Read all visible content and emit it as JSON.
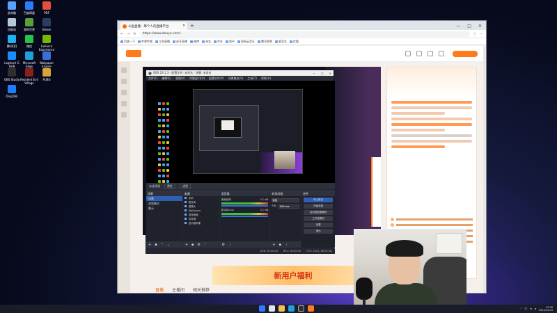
{
  "desktop": {
    "icons": [
      {
        "label": "此电脑",
        "color": "#5aa0ff"
      },
      {
        "label": "百度网盘",
        "color": "#2f7bff"
      },
      {
        "label": "PDF",
        "color": "#e84d3d"
      },
      {
        "label": "回收站",
        "color": "#b8c7d8"
      },
      {
        "label": "我的世界",
        "color": "#5a9f3a"
      },
      {
        "label": "Steam",
        "color": "#2a3f5f"
      },
      {
        "label": "腾讯QQ",
        "color": "#22b0f0"
      },
      {
        "label": "微信",
        "color": "#27c24c"
      },
      {
        "label": "GeForce Experience",
        "color": "#76b900"
      },
      {
        "label": "Logitech G HUB",
        "color": "#1a8cff"
      },
      {
        "label": "Microsoft Edge",
        "color": "#1fa0d8"
      },
      {
        "label": "Wallpaper Engine",
        "color": "#3a6fd8"
      },
      {
        "label": "OBS Studio",
        "color": "#302e31"
      },
      {
        "label": "Resident Evil Village",
        "color": "#8a1f1f"
      },
      {
        "label": "PUBG",
        "color": "#d6a43a"
      },
      {
        "label": "DingTalk",
        "color": "#1f7cff"
      }
    ]
  },
  "browser": {
    "tab_title": "斗鱼直播 - 每个人的直播平台",
    "new_tab": "+",
    "window_controls": [
      "—",
      "□",
      "✕"
    ],
    "url": "https://www.douyu.com/",
    "bookmarks": [
      "百度一下",
      "哔哩哔哩",
      "斗鱼直播",
      "虎牙直播",
      "微博",
      "淘宝",
      "京东",
      "知乎",
      "网易云音乐",
      "腾讯视频",
      "爱奇艺",
      "优酷"
    ],
    "promo_text": "新用户福利",
    "site_tabs": [
      "直播",
      "主播间",
      "相关推荐"
    ]
  },
  "obs": {
    "title": "OBS 29.1.3 - 配置文件: 未命名 - 场景: 未命名",
    "menu": [
      "文件(F)",
      "编辑(E)",
      "视图(V)",
      "停靠窗口(D)",
      "配置文件(P)",
      "场景集合(S)",
      "工具(T)",
      "帮助(H)"
    ],
    "toolbar": {
      "label": "未选择源",
      "properties": "属性",
      "filters": "滤镜"
    },
    "docks": {
      "scenes": {
        "title": "场景",
        "items": [
          "场景",
          "游戏模式",
          "聊天"
        ]
      },
      "sources": {
        "title": "来源",
        "items": [
          "手机",
          "麦克风",
          "摄像头",
          "Wallpaper",
          "游戏画面",
          "浏览器",
          "显示器采集"
        ]
      },
      "mixer": {
        "title": "混音器",
        "channels": [
          {
            "name": "桌面音频",
            "level": "0.0 dB"
          },
          {
            "name": "麦克风/Aux",
            "level": "0.0 dB"
          }
        ]
      },
      "transitions": {
        "title": "转场动画",
        "type": "淡出",
        "duration_label": "时长",
        "duration": "300 ms"
      },
      "controls": {
        "title": "控件",
        "buttons": [
          "停止推流",
          "开始录制",
          "启动虚拟摄像机",
          "工作室模式",
          "设置",
          "退出"
        ]
      }
    },
    "status": [
      "LIVE: 00:00:00",
      "REC: 00:00:00",
      "CPU: 0.0%, 60.00 fps"
    ]
  },
  "taskbar": {
    "time": "19:38",
    "date": "2024/12/23",
    "lang": "中"
  }
}
